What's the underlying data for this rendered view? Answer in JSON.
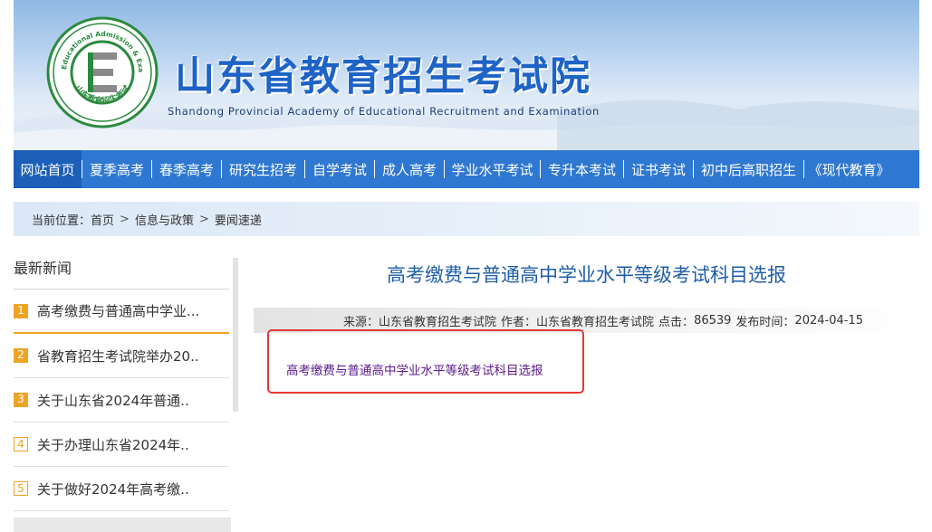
{
  "site": {
    "title_cn": "山东省教育招生考试院",
    "title_en": "Shandong Provincial Academy of Educational Recruitment and Examination",
    "logo_ring_text": "Shandong Educational Admission & Examinations",
    "logo_ring_text_cn": "山东教育招生考试",
    "logo_letter": "E"
  },
  "nav": {
    "items": [
      {
        "label": "网站首页",
        "active": true
      },
      {
        "label": "夏季高考"
      },
      {
        "label": "春季高考"
      },
      {
        "label": "研究生招考"
      },
      {
        "label": "自学考试"
      },
      {
        "label": "成人高考"
      },
      {
        "label": "学业水平考试"
      },
      {
        "label": "专升本考试"
      },
      {
        "label": "证书考试"
      },
      {
        "label": "初中后高职招生"
      },
      {
        "label": "《现代教育》"
      }
    ]
  },
  "breadcrumb": {
    "prefix": "当前位置：",
    "items": [
      "首页",
      "信息与政策",
      "要闻速递"
    ],
    "separator": ">"
  },
  "sidebar": {
    "title": "最新新闻",
    "items": [
      {
        "num": "1",
        "label": "高考缴费与普通高中学业..."
      },
      {
        "num": "2",
        "label": "省教育招生考试院举办20.."
      },
      {
        "num": "3",
        "label": "关于山东省2024年普通.."
      },
      {
        "num": "4",
        "label": "关于办理山东省2024年.."
      },
      {
        "num": "5",
        "label": "关于做好2024年高考缴.."
      }
    ]
  },
  "article": {
    "title": "高考缴费与普通高中学业水平等级考试科目选报",
    "meta": {
      "source_label": "来源：",
      "source": "山东省教育招生考试院",
      "author_label": "作者：",
      "author": "山东省教育招生考试院",
      "hits_label": "点击：",
      "hits": "86539",
      "date_label": "发布时间：",
      "date": "2024-04-15"
    },
    "attachment": "高考缴费与普通高中学业水平等级考试科目选报"
  },
  "colors": {
    "nav_bg": "#2f78d1",
    "nav_active": "#1b5fb8",
    "title_blue": "#1f5ea8",
    "badge_orange": "#f0a423",
    "highlight_red": "#e53935",
    "link_purple": "#5b1a8b"
  }
}
